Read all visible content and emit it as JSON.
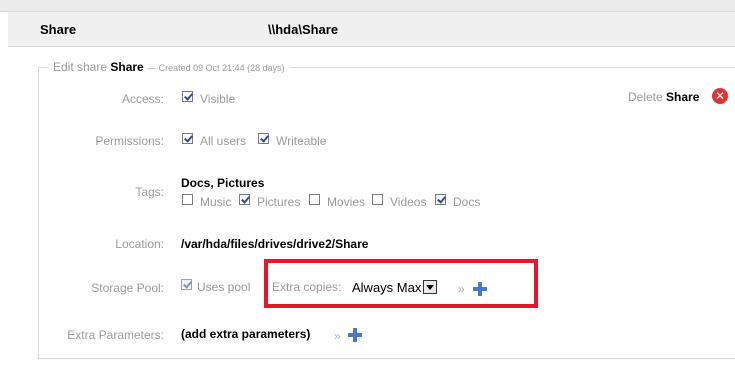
{
  "header": {
    "share_name": "Share",
    "share_path": "\\\\hda\\Share"
  },
  "edit": {
    "prefix": "Edit share",
    "name": "Share",
    "created": "— Created 09 Oct 21:44 (28 days)"
  },
  "delete": {
    "label": "Delete",
    "name": "Share"
  },
  "access": {
    "label": "Access:",
    "visible_label": "Visible",
    "visible_checked": true
  },
  "permissions": {
    "label": "Permissions:",
    "all_users_label": "All users",
    "all_users_checked": true,
    "writeable_label": "Writeable",
    "writeable_checked": true
  },
  "tags": {
    "label": "Tags:",
    "current": "Docs, Pictures",
    "options": [
      {
        "label": "Music",
        "checked": false
      },
      {
        "label": "Pictures",
        "checked": true
      },
      {
        "label": "Movies",
        "checked": false
      },
      {
        "label": "Videos",
        "checked": false
      },
      {
        "label": "Docs",
        "checked": true
      }
    ]
  },
  "location": {
    "label": "Location:",
    "value": "/var/hda/files/drives/drive2/Share"
  },
  "storage_pool": {
    "label": "Storage Pool:",
    "uses_pool_label": "Uses pool",
    "uses_pool_checked": true,
    "extra_copies_label": "Extra copies:",
    "extra_copies_value": "Always Max"
  },
  "extra_parameters": {
    "label": "Extra Parameters:",
    "link": "(add extra parameters)"
  },
  "icons": {
    "delete": "close-circle-icon",
    "add": "plus-icon",
    "more": "double-chevron-right-icon"
  },
  "colors": {
    "highlight": "#e3192b",
    "delete_icon": "#dd3333",
    "add_icon": "#4a78c8"
  }
}
